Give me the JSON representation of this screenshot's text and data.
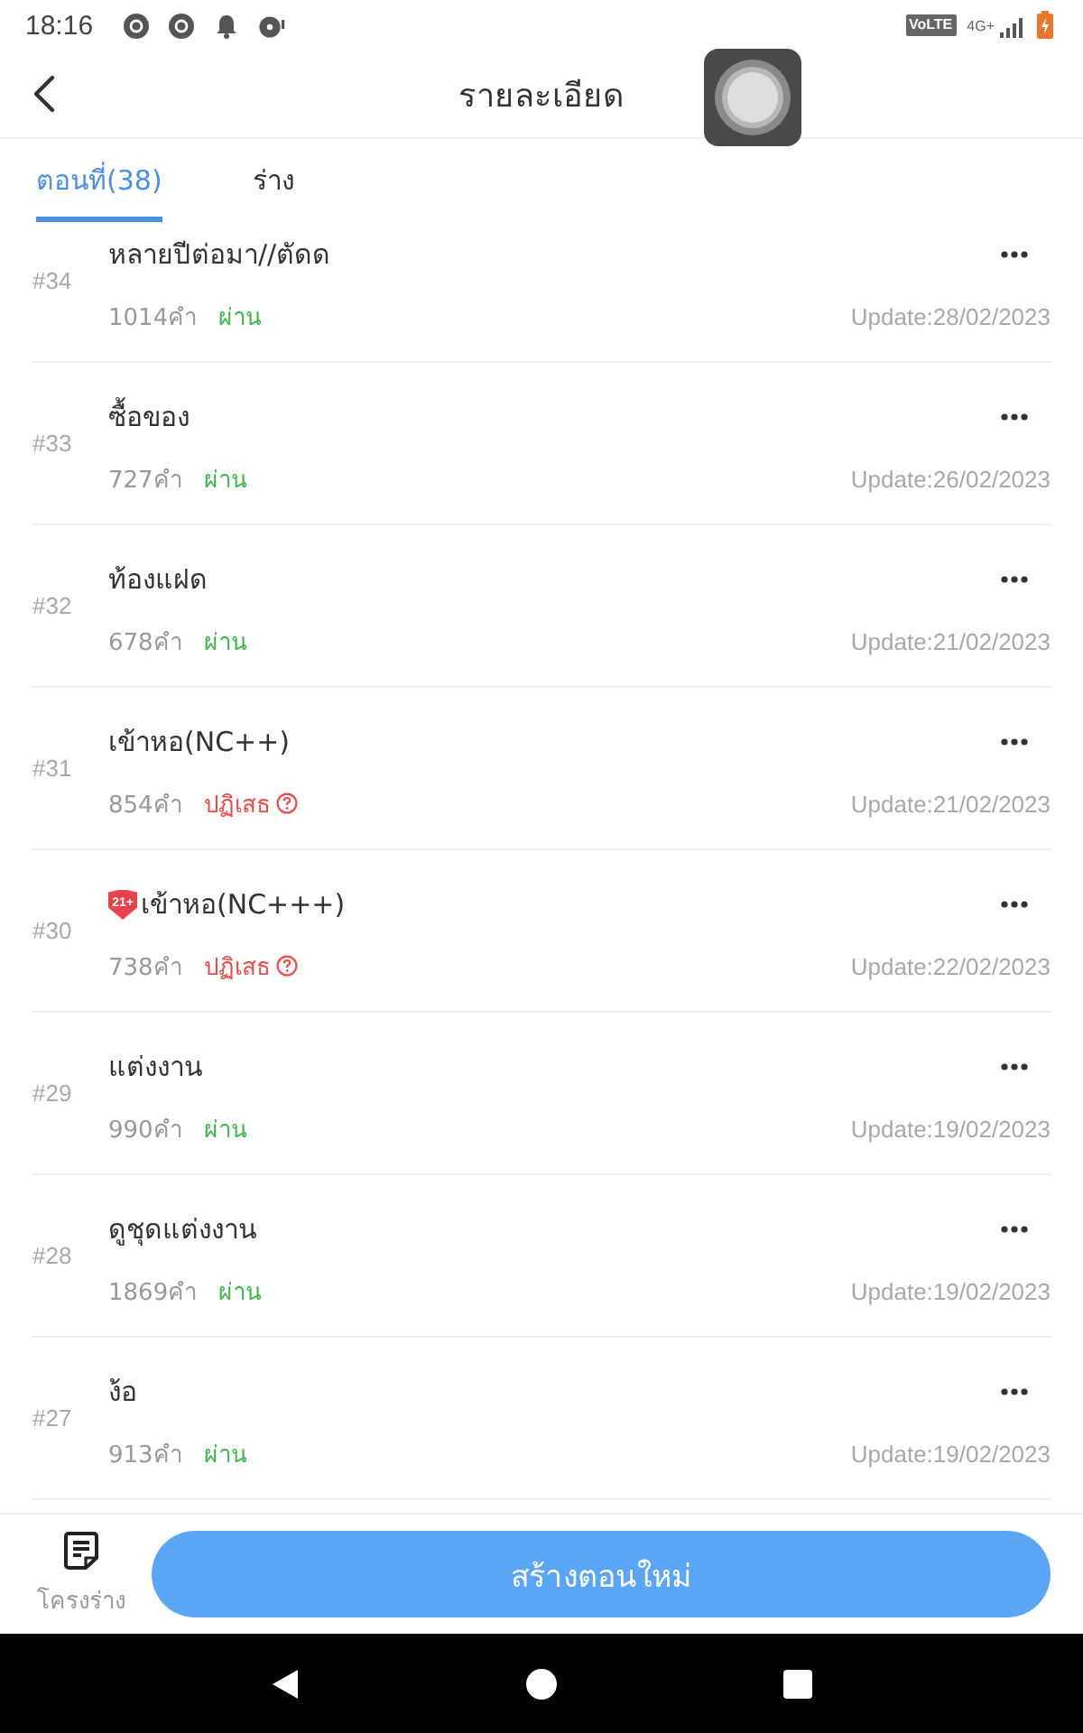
{
  "status_bar": {
    "time": "18:16",
    "volte": "VoLTE",
    "network": "4G+"
  },
  "header": {
    "title": "รายละเอียด"
  },
  "tabs": [
    {
      "label": "ตอนที่(38)",
      "selected": true
    },
    {
      "label": "ร่าง",
      "selected": false
    }
  ],
  "chapters": [
    {
      "number": "#34",
      "title": "หลายปีต่อมา//ตัดด",
      "words": "1014คำ",
      "status": {
        "text": "ผ่าน",
        "kind": "approved"
      },
      "updated": "Update:28/02/2023"
    },
    {
      "number": "#33",
      "title": "ซื้อของ",
      "words": "727คำ",
      "status": {
        "text": "ผ่าน",
        "kind": "approved"
      },
      "updated": "Update:26/02/2023"
    },
    {
      "number": "#32",
      "title": "ท้องแฝด",
      "words": "678คำ",
      "status": {
        "text": "ผ่าน",
        "kind": "approved"
      },
      "updated": "Update:21/02/2023"
    },
    {
      "number": "#31",
      "title": "เข้าหอ(NC++)",
      "words": "854คำ",
      "status": {
        "text": "ปฏิเสธ",
        "kind": "rejected"
      },
      "updated": "Update:21/02/2023"
    },
    {
      "number": "#30",
      "badge": "21+",
      "title": "เข้าหอ(NC+++)",
      "words": "738คำ",
      "status": {
        "text": "ปฏิเสธ",
        "kind": "rejected"
      },
      "updated": "Update:22/02/2023"
    },
    {
      "number": "#29",
      "title": "แต่งงาน",
      "words": "990คำ",
      "status": {
        "text": "ผ่าน",
        "kind": "approved"
      },
      "updated": "Update:19/02/2023"
    },
    {
      "number": "#28",
      "title": "ดูชุดแต่งงาน",
      "words": "1869คำ",
      "status": {
        "text": "ผ่าน",
        "kind": "approved"
      },
      "updated": "Update:19/02/2023"
    },
    {
      "number": "#27",
      "title": "ง้อ",
      "words": "913คำ",
      "status": {
        "text": "ผ่าน",
        "kind": "approved"
      },
      "updated": "Update:19/02/2023"
    }
  ],
  "bottom_bar": {
    "outline_label": "โครงร่าง",
    "create_button": "สร้างตอนใหม่"
  }
}
